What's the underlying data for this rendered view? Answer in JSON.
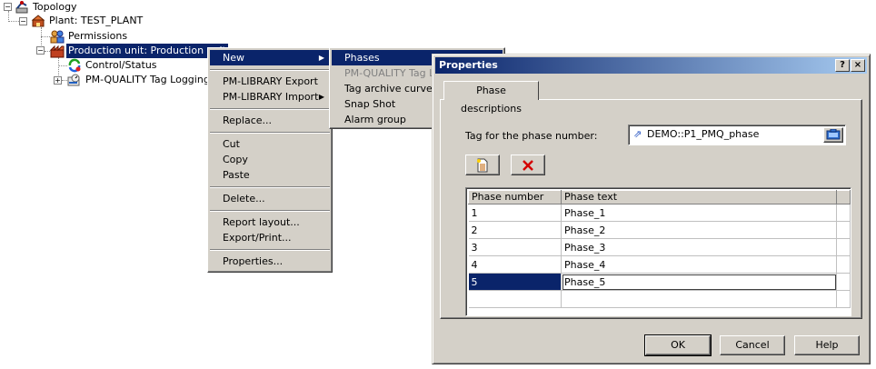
{
  "tree": {
    "root": "Topology",
    "plant": "Plant: TEST_PLANT",
    "permissions": "Permissions",
    "production_unit": "Production unit: Production unit",
    "control_status": "Control/Status",
    "pmq_tag_logging": "PM-QUALITY Tag Logging"
  },
  "context_menu": {
    "new": "New",
    "pm_library_export": "PM-LIBRARY Export",
    "pm_library_import": "PM-LIBRARY Import",
    "replace": "Replace...",
    "cut": "Cut",
    "copy": "Copy",
    "paste": "Paste",
    "delete": "Delete...",
    "report_layout": "Report layout...",
    "export_print": "Export/Print...",
    "properties": "Properties..."
  },
  "submenu": {
    "phases": "Phases",
    "pmq_tag_logging": "PM-QUALITY Tag Lo",
    "tag_archive_curve": "Tag archive curve",
    "snap_shot": "Snap Shot",
    "alarm_group": "Alarm group"
  },
  "dialog": {
    "title": "Properties",
    "help_caption": "?",
    "close_caption": "×",
    "tab_label": "Phase descriptions",
    "tag_label": "Tag for the phase number:",
    "tag_value": "DEMO::P1_PMQ_phase",
    "table": {
      "headers": [
        "Phase number",
        "Phase text"
      ],
      "rows": [
        [
          "1",
          "Phase_1"
        ],
        [
          "2",
          "Phase_2"
        ],
        [
          "3",
          "Phase_3"
        ],
        [
          "4",
          "Phase_4"
        ],
        [
          "5",
          "Phase_5"
        ]
      ]
    },
    "ok": "OK",
    "cancel": "Cancel",
    "help": "Help"
  },
  "colors": {
    "selection": "#0a246a",
    "face": "#d4d0c8",
    "delete_red": "#d40000"
  }
}
